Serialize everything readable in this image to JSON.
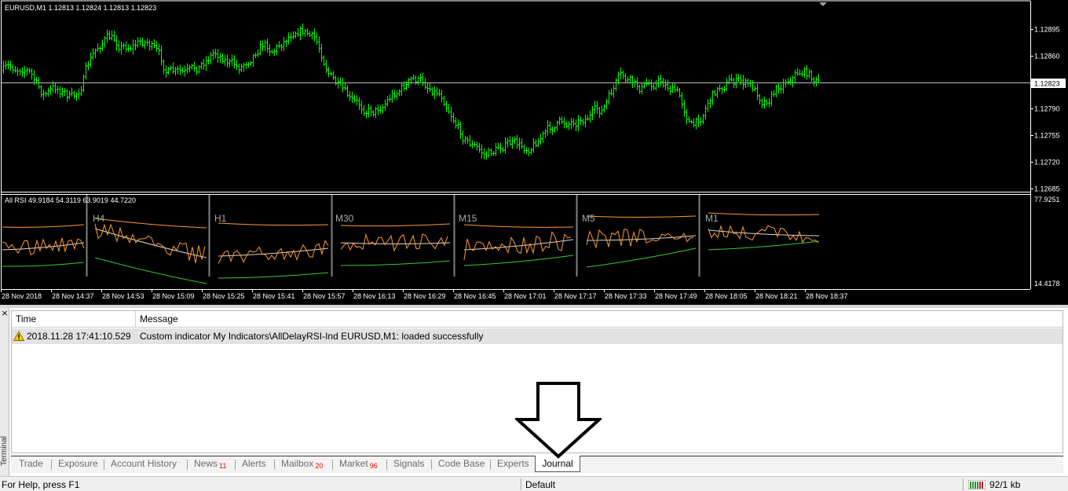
{
  "chart_window": {
    "title": "EURUSD,M1  1.12813 1.12824 1.12813 1.12823",
    "price_labels": [
      "1.12895",
      "1.12860",
      "1.12823",
      "1.12790",
      "1.12755",
      "1.12720",
      "1.12685"
    ],
    "current_price": "1.12823",
    "colors": {
      "background": "#000000",
      "bars": "#00ff00",
      "grid_line": "#c0c0c0",
      "price_tag_bg": "#ffffff"
    }
  },
  "indicator": {
    "title": "All RSI 49.9184 54.3119 63.9019 44.7220",
    "scale_top": "77.9251",
    "scale_bottom": "14.4178",
    "timeframes": [
      "H4",
      "H1",
      "M30",
      "M15",
      "M5",
      "M1"
    ],
    "colors": {
      "upper_band": "#ff9933",
      "rsi": "#ff9933",
      "middle": "#d8d8d8",
      "lower_band": "#33cc33",
      "separator": "#808080"
    }
  },
  "time_axis": {
    "labels": [
      "28 Nov 2018",
      "28 Nov 14:37",
      "28 Nov 14:53",
      "28 Nov 15:09",
      "28 Nov 15:25",
      "28 Nov 15:41",
      "28 Nov 15:57",
      "28 Nov 16:13",
      "28 Nov 16:29",
      "28 Nov 16:45",
      "28 Nov 17:01",
      "28 Nov 17:17",
      "28 Nov 17:33",
      "28 Nov 17:49",
      "28 Nov 18:05",
      "28 Nov 18:21",
      "28 Nov 18:37"
    ]
  },
  "terminal": {
    "vertical_label": "Terminal",
    "close_glyph": "×",
    "columns": {
      "time": "Time",
      "message": "Message"
    },
    "rows": [
      {
        "icon": "warning-icon",
        "time": "2018.11.28 17:41:10.529",
        "message": "Custom indicator My Indicators\\AllDelayRSI-Ind EURUSD,M1: loaded successfully"
      }
    ],
    "tabs": [
      {
        "label": "Trade",
        "badge": ""
      },
      {
        "label": "Exposure",
        "badge": ""
      },
      {
        "label": "Account History",
        "badge": ""
      },
      {
        "label": "News",
        "badge": "11"
      },
      {
        "label": "Alerts",
        "badge": ""
      },
      {
        "label": "Mailbox",
        "badge": "20"
      },
      {
        "label": "Market",
        "badge": "96"
      },
      {
        "label": "Signals",
        "badge": ""
      },
      {
        "label": "Code Base",
        "badge": ""
      },
      {
        "label": "Experts",
        "badge": ""
      },
      {
        "label": "Journal",
        "badge": "",
        "active": true
      }
    ]
  },
  "status_bar": {
    "help_text": "For Help, press F1",
    "profile": "Default",
    "traffic": "92/1 kb",
    "connection_icon": "connection-bars-icon"
  },
  "annotation": {
    "icon": "down-arrow-icon"
  }
}
